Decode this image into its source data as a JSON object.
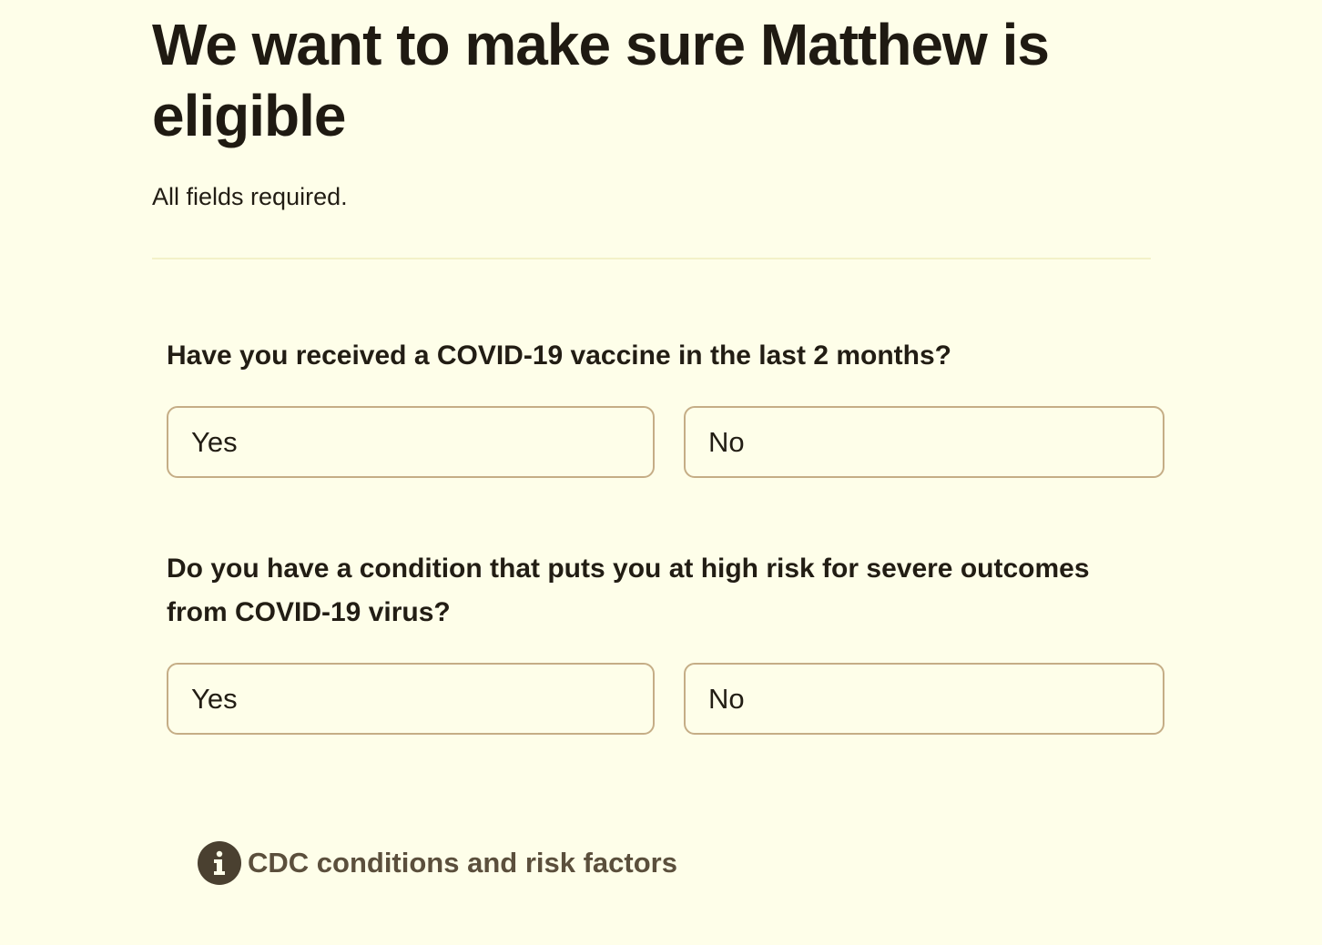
{
  "header": {
    "title": "We want to make sure Matthew is eligible",
    "required_note": "All fields required."
  },
  "questions": [
    {
      "text": "Have you received a COVID-19 vaccine in the last 2 months?",
      "options": [
        "Yes",
        "No"
      ]
    },
    {
      "text": "Do you have a condition that puts you at high risk for severe outcomes from COVID-19 virus?",
      "options": [
        "Yes",
        "No"
      ]
    }
  ],
  "info_link": {
    "icon": "info-icon",
    "label": "CDC conditions and risk factors"
  },
  "colors": {
    "background": "#fefee9",
    "text": "#221d14",
    "option_border": "#c5ad86",
    "link": "#5b4f3c",
    "icon_fill": "#4a4030"
  }
}
